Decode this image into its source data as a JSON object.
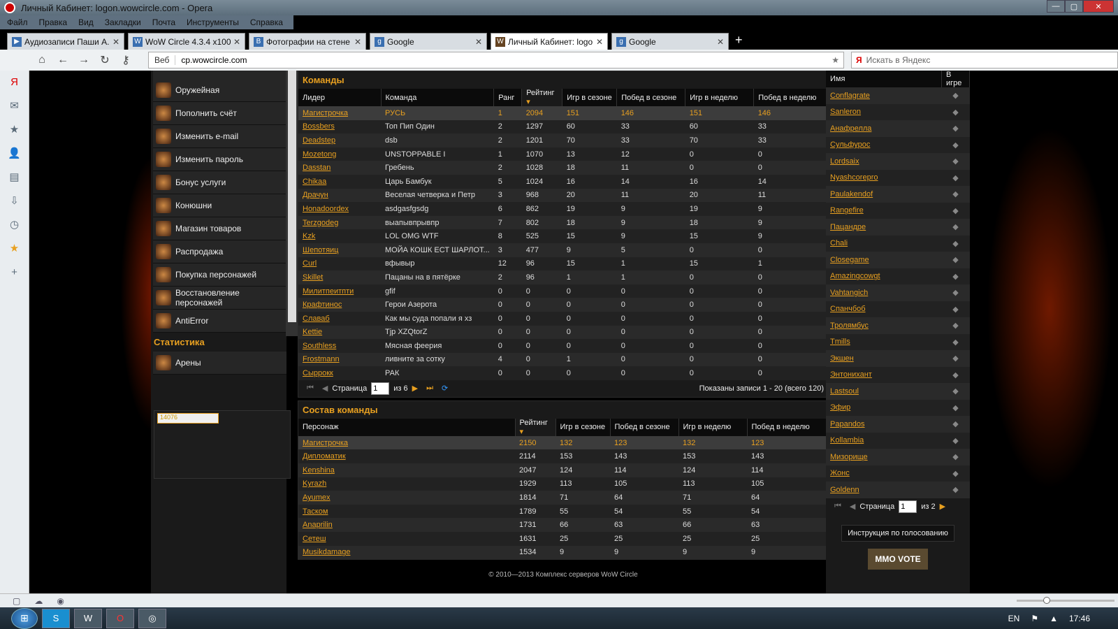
{
  "window": {
    "title": "Личный Кабинет: logon.wowcircle.com - Opera"
  },
  "menu": [
    "Файл",
    "Правка",
    "Вид",
    "Закладки",
    "Почта",
    "Инструменты",
    "Справка"
  ],
  "tabs": [
    {
      "label": "Аудиозаписи Паши А..."
    },
    {
      "label": "WoW Circle 4.3.4 x100"
    },
    {
      "label": "Фотографии на стене ..."
    },
    {
      "label": "Google"
    },
    {
      "label": "Личный Кабинет: logo..."
    },
    {
      "label": "Google"
    }
  ],
  "address": {
    "web": "Веб",
    "url": "cp.wowcircle.com",
    "search_placeholder": "Искать в Яндекс"
  },
  "sidebar": {
    "items": [
      "Оружейная",
      "Пополнить счёт",
      "Изменить e-mail",
      "Изменить пароль",
      "Бонус услуги",
      "Конюшни",
      "Магазин товаров",
      "Распродажа",
      "Покупка персонажей",
      "Восстановление персонажей",
      "AntiError"
    ],
    "stats_title": "Статистика",
    "stats_items": [
      "Арены"
    ],
    "counter": "14076"
  },
  "teams": {
    "title": "Команды",
    "columns": [
      "Лидер",
      "Команда",
      "Ранг",
      "Рейтинг",
      "Игр в сезоне",
      "Побед в сезоне",
      "Игр в неделю",
      "Побед в неделю"
    ],
    "rows": [
      [
        "Магистрочка",
        "РУСЬ",
        "1",
        "2094",
        "151",
        "146",
        "151",
        "146"
      ],
      [
        "Bossbers",
        "Топ Пип Один",
        "2",
        "1297",
        "60",
        "33",
        "60",
        "33"
      ],
      [
        "Deadstep",
        "dsb",
        "2",
        "1201",
        "70",
        "33",
        "70",
        "33"
      ],
      [
        "Mozetong",
        "UNSTOPPABLE I",
        "1",
        "1070",
        "13",
        "12",
        "0",
        "0"
      ],
      [
        "Dasstan",
        "Гребень",
        "2",
        "1028",
        "18",
        "11",
        "0",
        "0"
      ],
      [
        "Chikaa",
        "Царь Бамбук",
        "5",
        "1024",
        "16",
        "14",
        "16",
        "14"
      ],
      [
        "Драчун",
        "Веселая четверка и Петр",
        "3",
        "968",
        "20",
        "11",
        "20",
        "11"
      ],
      [
        "Honadoordex",
        "asdgasfgsdg",
        "6",
        "862",
        "19",
        "9",
        "19",
        "9"
      ],
      [
        "Terzgodeg",
        "выапывпрывпр",
        "7",
        "802",
        "18",
        "9",
        "18",
        "9"
      ],
      [
        "Kzk",
        "LOL OMG WTF",
        "8",
        "525",
        "15",
        "9",
        "15",
        "9"
      ],
      [
        "Шепотяиц",
        "МОЙА КОШК ЕСТ ШАРЛОТ...",
        "3",
        "477",
        "9",
        "5",
        "0",
        "0"
      ],
      [
        "Curl",
        "вфывыр",
        "12",
        "96",
        "15",
        "1",
        "15",
        "1"
      ],
      [
        "Skillet",
        "Пацаны на в пятёрке",
        "2",
        "96",
        "1",
        "1",
        "0",
        "0"
      ],
      [
        "Милитпеитпти",
        "gfif",
        "0",
        "0",
        "0",
        "0",
        "0",
        "0"
      ],
      [
        "Крафтинос",
        "Герои Азерота",
        "0",
        "0",
        "0",
        "0",
        "0",
        "0"
      ],
      [
        "Славаб",
        "Как мы суда попали я хз",
        "0",
        "0",
        "0",
        "0",
        "0",
        "0"
      ],
      [
        "Kettie",
        "Tjp XZQtorZ",
        "0",
        "0",
        "0",
        "0",
        "0",
        "0"
      ],
      [
        "Southless",
        "Мясная феерия",
        "0",
        "0",
        "0",
        "0",
        "0",
        "0"
      ],
      [
        "Frostmann",
        "ливните за сотку",
        "4",
        "0",
        "1",
        "0",
        "0",
        "0"
      ],
      [
        "Сыррокк",
        "РАК",
        "0",
        "0",
        "0",
        "0",
        "0",
        "0"
      ]
    ],
    "pager": {
      "page_label": "Страница",
      "page": "1",
      "of": "из 6",
      "info": "Показаны записи 1 - 20 (всего 120)"
    }
  },
  "roster": {
    "title": "Состав команды",
    "columns": [
      "Персонаж",
      "Рейтинг",
      "Игр в сезоне",
      "Побед в сезоне",
      "Игр в неделю",
      "Побед в неделю"
    ],
    "rows": [
      [
        "Магистрочка",
        "2150",
        "132",
        "123",
        "132",
        "123"
      ],
      [
        "Дипломатик",
        "2114",
        "153",
        "143",
        "153",
        "143"
      ],
      [
        "Kenshina",
        "2047",
        "124",
        "114",
        "124",
        "114"
      ],
      [
        "Kyrazh",
        "1929",
        "113",
        "105",
        "113",
        "105"
      ],
      [
        "Ayumex",
        "1814",
        "71",
        "64",
        "71",
        "64"
      ],
      [
        "Таском",
        "1789",
        "55",
        "54",
        "55",
        "54"
      ],
      [
        "Anaprilin",
        "1731",
        "66",
        "63",
        "66",
        "63"
      ],
      [
        "Сетеш",
        "1631",
        "25",
        "25",
        "25",
        "25"
      ],
      [
        "Musikdamage",
        "1534",
        "9",
        "9",
        "9",
        "9"
      ]
    ]
  },
  "online": {
    "columns": [
      "Имя",
      "В игре"
    ],
    "names": [
      "Conflagrate",
      "Sanleron",
      "Анафрелла",
      "Сульфурос",
      "Lordsaix",
      "Nyashcorepro",
      "Paulakendof",
      "Rangefire",
      "Пацандре",
      "Chali",
      "Closegame",
      "Amazingcowgt",
      "Vahtangich",
      "Спанчбоб",
      "Тролямбус",
      "Tmills",
      "Экшен",
      "Энтонихант",
      "Lastsoul",
      "Эфир",
      "Papandos",
      "Kollambia",
      "Мизорище",
      "Жонс",
      "Goldenn"
    ],
    "pager": {
      "page_label": "Страница",
      "page": "1",
      "of": "из 2"
    },
    "vote_button": "Инструкция по голосованию",
    "vote_banner": "MMO VOTE"
  },
  "footer": "© 2010—2013 Комплекс серверов WoW Circle",
  "tray": {
    "lang": "EN",
    "time": "17:46"
  }
}
